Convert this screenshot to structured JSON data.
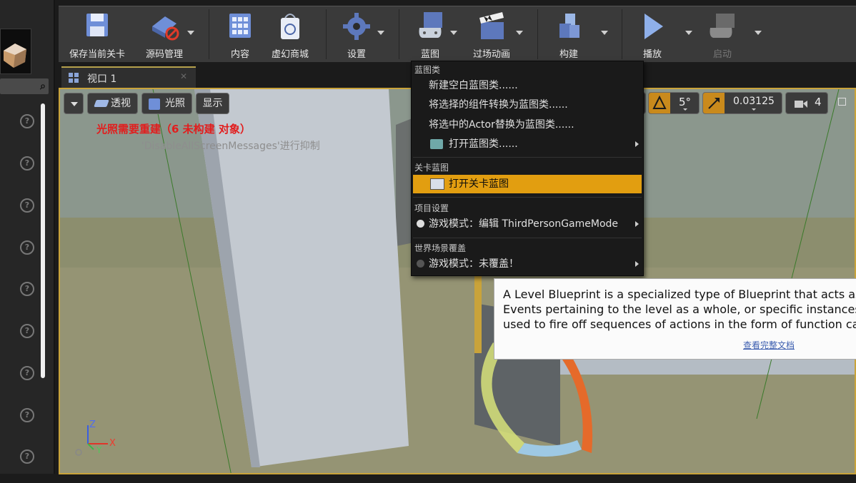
{
  "toolbar": {
    "save": "保存当前关卡",
    "source_control": "源码管理",
    "content": "内容",
    "marketplace": "虚幻商城",
    "settings": "设置",
    "blueprints": "蓝图",
    "cinematics": "过场动画",
    "build": "构建",
    "play": "播放",
    "launch": "启动"
  },
  "tab": {
    "label": "视口 1"
  },
  "viewport": {
    "view_mode": "透视",
    "lighting": "光照",
    "show": "显示",
    "lighting_warning": "光照需要重建（6 未构建 对象）",
    "suppress_message": "'DisableAllScreenMessages'进行抑制",
    "rotation_snap": "5°",
    "scale_snap": "0.03125",
    "camera_speed": "4",
    "axis_z": "Z",
    "axis_x": "X",
    "axis_y": "Y"
  },
  "menu": {
    "section_blueprint_class": "蓝图类",
    "new_empty_blueprint": "新建空白蓝图类......",
    "convert_components": "将选择的组件转换为蓝图类......",
    "replace_actor": "将选中的Actor替换为蓝图类......",
    "open_blueprint_class": "打开蓝图类......",
    "section_level_blueprint": "关卡蓝图",
    "open_level_blueprint": "打开关卡蓝图",
    "section_project_settings": "项目设置",
    "game_mode_edit": "游戏模式：编辑 ThirdPersonGameMode",
    "section_world_override": "世界场景覆盖",
    "game_mode_override": "游戏模式：未覆盖！"
  },
  "tooltip": {
    "line1": "A Level Blueprint is a specialized type of Blueprint that acts as",
    "line2": "Events pertaining to the level as a whole, or specific instances o",
    "line3": "used to fire off sequences of actions in the form of function cal",
    "link": "查看完整文档"
  },
  "colors": {
    "highlight": "#e29e10",
    "viewport_border": "#c9a33a",
    "warning": "#e21d1d"
  }
}
